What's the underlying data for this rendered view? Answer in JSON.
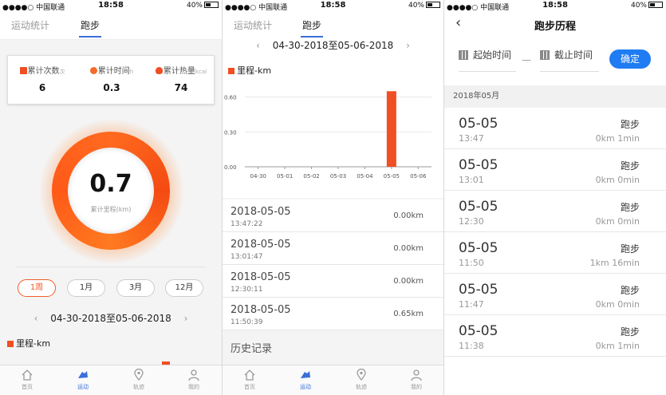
{
  "status": {
    "carrier": "●●●●○ 中国联通",
    "time": "18:58",
    "battery": "40%"
  },
  "screen1": {
    "tabs": [
      "运动统计",
      "跑步"
    ],
    "stats": [
      {
        "label": "累计次数",
        "unit": "次",
        "value": "6",
        "icon_color": "#f04e23"
      },
      {
        "label": "累计时间",
        "unit": "h",
        "value": "0.3",
        "icon_color": "#f56a2a"
      },
      {
        "label": "累计热量",
        "unit": "kcal",
        "value": "74",
        "icon_color": "#f04e23"
      }
    ],
    "ring": {
      "value": "0.7",
      "label": "累计里程(km)"
    },
    "periods": [
      "1周",
      "1月",
      "3月",
      "12月"
    ],
    "active_period": 0,
    "daterange": "04-30-2018至05-06-2018",
    "legend": "里程-km"
  },
  "nav": [
    {
      "label": "首页",
      "icon": "home-icon"
    },
    {
      "label": "运动",
      "icon": "run-icon"
    },
    {
      "label": "轨迹",
      "icon": "location-icon"
    },
    {
      "label": "我的",
      "icon": "person-icon"
    }
  ],
  "screen2": {
    "tabs": [
      "运动统计",
      "跑步"
    ],
    "daterange": "04-30-2018至05-06-2018",
    "legend": "里程-km",
    "chart_data": {
      "type": "bar",
      "categories": [
        "04-30",
        "05-01",
        "05-02",
        "05-03",
        "05-04",
        "05-05",
        "05-06"
      ],
      "values": [
        0,
        0,
        0,
        0,
        0,
        0.65,
        0
      ],
      "yticks": [
        "0.00",
        "0.30",
        "0.60"
      ],
      "ylim": [
        0,
        0.7
      ],
      "bar_color": "#f04e23",
      "title": "",
      "xlabel": "",
      "ylabel": ""
    },
    "records": [
      {
        "date": "2018-05-05",
        "time": "13:47:22",
        "dist": "0.00km"
      },
      {
        "date": "2018-05-05",
        "time": "13:01:47",
        "dist": "0.00km"
      },
      {
        "date": "2018-05-05",
        "time": "12:30:11",
        "dist": "0.00km"
      },
      {
        "date": "2018-05-05",
        "time": "11:50:39",
        "dist": "0.65km"
      }
    ],
    "history_title": "历史记录"
  },
  "screen3": {
    "title": "跑步历程",
    "start_label": "起始时间",
    "end_label": "截止时间",
    "dash": "—",
    "confirm": "确定",
    "month": "2018年05月",
    "records": [
      {
        "date": "05-05",
        "time": "13:47",
        "kind": "跑步",
        "value": "0km 1min"
      },
      {
        "date": "05-05",
        "time": "13:01",
        "kind": "跑步",
        "value": "0km 0min"
      },
      {
        "date": "05-05",
        "time": "12:30",
        "kind": "跑步",
        "value": "0km 0min"
      },
      {
        "date": "05-05",
        "time": "11:50",
        "kind": "跑步",
        "value": "1km 16min"
      },
      {
        "date": "05-05",
        "time": "11:47",
        "kind": "跑步",
        "value": "0km 0min"
      },
      {
        "date": "05-05",
        "time": "11:38",
        "kind": "跑步",
        "value": "0km 1min"
      }
    ]
  }
}
